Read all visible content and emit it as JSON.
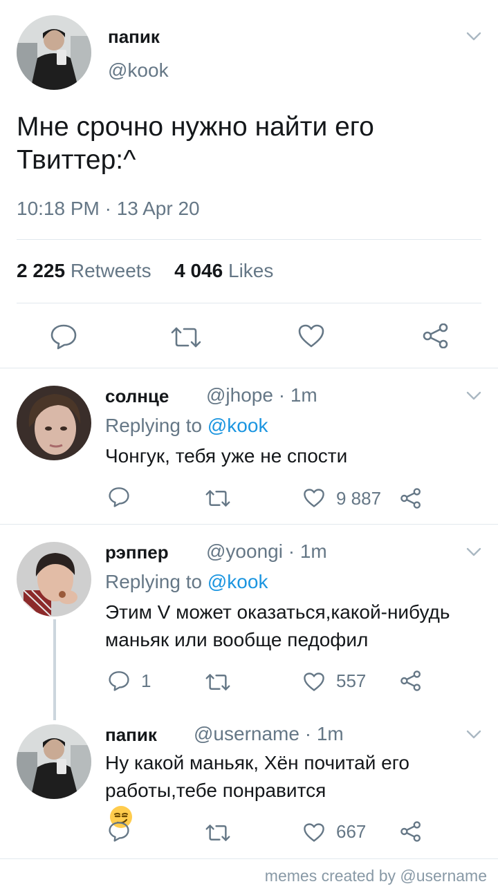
{
  "main_tweet": {
    "author_name": "папик",
    "author_handle": "@kook",
    "text_line1": "Мне срочно нужно найти его",
    "text_line2": "Твиттер:^",
    "timestamp": "10:18 PM · 13 Apr 20",
    "retweets_count": "2 225",
    "retweets_label": "Retweets",
    "likes_count": "4 046",
    "likes_label": "Likes"
  },
  "replies": [
    {
      "name": "солнце",
      "meta": "@jhope · 1m",
      "replying_prefix": "Replying to ",
      "replying_handle": "@kook",
      "lines": [
        "Чонгук, тебя уже не спости"
      ],
      "reply_count": "",
      "like_count": "9 887"
    },
    {
      "name": "рэппер",
      "meta": "@yoongi · 1m",
      "replying_prefix": "Replying to ",
      "replying_handle": "@kook",
      "lines": [
        "Этим V может оказаться,какой-нибудь",
        "маньяк или вообще педофил"
      ],
      "reply_count": "1",
      "like_count": "557"
    },
    {
      "name": "папик",
      "meta": "@username · 1m",
      "lines": [
        "Ну какой маньяк, Хён почитай его",
        "работы,тебе понравится"
      ],
      "reply_count": "",
      "like_count": "667",
      "emoji": "smirking-face-emoji"
    }
  ],
  "footer": "memes created by @username",
  "colors": {
    "link": "#1b95e0",
    "muted": "#657786",
    "text": "#14171a",
    "divider": "#e1e8ed"
  }
}
